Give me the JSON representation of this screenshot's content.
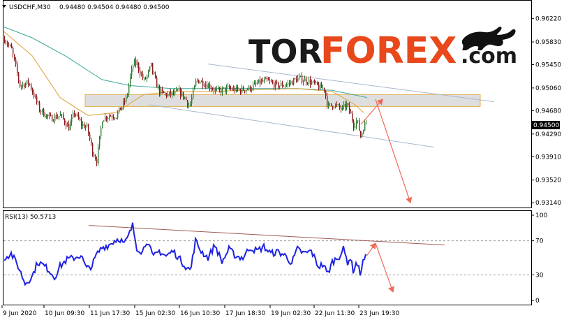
{
  "header": {
    "symbol": "USDCHF,M30",
    "ohlc": "0.94480 0.94504 0.94480 0.94500"
  },
  "logo": {
    "part1": "TOR",
    "part2": "FOREX",
    "part3": ".com"
  },
  "price_tag": "0.94500",
  "rsi_title": "RSI(13) 50.5713",
  "colors": {
    "bull_candle": "#2e7d32",
    "bear_candle": "#8b1a1a",
    "ma_fast": "#e0a030",
    "ma_slow": "#3aa89a",
    "channel": "#a8b8d0",
    "zone_fill": "#d8d8d8",
    "zone_border": "#e0b050",
    "arrow": "#ee6a5a",
    "rsi_line": "#1e22e0",
    "rsi_trend": "#a05a50",
    "logo_accent": "#e8481c"
  },
  "chart_data": [
    {
      "type": "candlestick",
      "title": "USDCHF,M30",
      "x_labels": [
        "9 Jun 2020",
        "10 Jun 09:30",
        "11 Jun 17:30",
        "15 Jun 02:30",
        "16 Jun 10:30",
        "17 Jun 18:30",
        "19 Jun 02:30",
        "22 Jun 11:30",
        "23 Jun 19:30"
      ],
      "y_ticks": [
        "0.96220",
        "0.95830",
        "0.95450",
        "0.95060",
        "0.94680",
        "0.94290",
        "0.93910",
        "0.93520",
        "0.93140"
      ],
      "ylim": [
        0.9306,
        0.9652
      ],
      "anchors": [
        [
          0,
          0.9588
        ],
        [
          10,
          0.957
        ],
        [
          22,
          0.951
        ],
        [
          35,
          0.9515
        ],
        [
          50,
          0.947
        ],
        [
          65,
          0.9455
        ],
        [
          80,
          0.946
        ],
        [
          92,
          0.944
        ],
        [
          100,
          0.9465
        ],
        [
          110,
          0.9445
        ],
        [
          118,
          0.944
        ],
        [
          126,
          0.94
        ],
        [
          132,
          0.9385
        ],
        [
          140,
          0.9455
        ],
        [
          150,
          0.946
        ],
        [
          160,
          0.946
        ],
        [
          168,
          0.9475
        ],
        [
          175,
          0.949
        ],
        [
          180,
          0.9525
        ],
        [
          185,
          0.9548
        ],
        [
          190,
          0.9545
        ],
        [
          195,
          0.953
        ],
        [
          200,
          0.9518
        ],
        [
          205,
          0.9528
        ],
        [
          210,
          0.9543
        ],
        [
          215,
          0.952
        ],
        [
          222,
          0.95
        ],
        [
          230,
          0.9495
        ],
        [
          240,
          0.9495
        ],
        [
          250,
          0.95
        ],
        [
          258,
          0.949
        ],
        [
          265,
          0.9475
        ],
        [
          275,
          0.952
        ],
        [
          290,
          0.9512
        ],
        [
          305,
          0.95
        ],
        [
          320,
          0.9505
        ],
        [
          335,
          0.9502
        ],
        [
          350,
          0.9505
        ],
        [
          365,
          0.9515
        ],
        [
          375,
          0.9518
        ],
        [
          390,
          0.951
        ],
        [
          405,
          0.9512
        ],
        [
          420,
          0.9522
        ],
        [
          435,
          0.9518
        ],
        [
          450,
          0.9508
        ],
        [
          458,
          0.9505
        ],
        [
          463,
          0.9475
        ],
        [
          473,
          0.9478
        ],
        [
          483,
          0.947
        ],
        [
          490,
          0.9478
        ],
        [
          495,
          0.9465
        ],
        [
          500,
          0.9445
        ],
        [
          505,
          0.9452
        ],
        [
          510,
          0.9425
        ],
        [
          514,
          0.944
        ],
        [
          518,
          0.945
        ]
      ],
      "ma_fast": [
        [
          0,
          0.96
        ],
        [
          40,
          0.956
        ],
        [
          80,
          0.949
        ],
        [
          120,
          0.946
        ],
        [
          160,
          0.9465
        ],
        [
          200,
          0.9495
        ],
        [
          240,
          0.95
        ],
        [
          300,
          0.95
        ],
        [
          360,
          0.9503
        ],
        [
          420,
          0.9505
        ],
        [
          470,
          0.95
        ],
        [
          500,
          0.948
        ],
        [
          515,
          0.9465
        ]
      ],
      "ma_slow": [
        [
          0,
          0.9608
        ],
        [
          40,
          0.959
        ],
        [
          90,
          0.9558
        ],
        [
          140,
          0.952
        ],
        [
          180,
          0.951
        ],
        [
          240,
          0.9505
        ],
        [
          300,
          0.9505
        ],
        [
          360,
          0.9505
        ],
        [
          420,
          0.9505
        ],
        [
          470,
          0.9502
        ],
        [
          520,
          0.949
        ]
      ],
      "channel_upper": [
        [
          292,
          0.9546
        ],
        [
          702,
          0.9483
        ]
      ],
      "channel_lower": [
        [
          207,
          0.9478
        ],
        [
          616,
          0.9407
        ]
      ],
      "zone": {
        "x0": 116,
        "x1": 682,
        "y_low": 0.9475,
        "y_high": 0.9495
      },
      "arrows": [
        {
          "from": [
            511,
            0.9445
          ],
          "to": [
            542,
            0.9487
          ]
        },
        {
          "from": [
            532,
            0.9487
          ],
          "to": [
            582,
            0.9314
          ]
        }
      ]
    },
    {
      "type": "line",
      "title": "RSI(13) 50.5713",
      "y_ticks": [
        "100",
        "70",
        "30",
        "0"
      ],
      "ylim": [
        0,
        100
      ],
      "levels": [
        30,
        70
      ],
      "anchors": [
        [
          0,
          50
        ],
        [
          10,
          55
        ],
        [
          20,
          40
        ],
        [
          30,
          20
        ],
        [
          40,
          28
        ],
        [
          48,
          45
        ],
        [
          55,
          42
        ],
        [
          65,
          35
        ],
        [
          72,
          27
        ],
        [
          80,
          40
        ],
        [
          90,
          48
        ],
        [
          100,
          50
        ],
        [
          110,
          53
        ],
        [
          118,
          37
        ],
        [
          126,
          41
        ],
        [
          132,
          53
        ],
        [
          140,
          62
        ],
        [
          150,
          65
        ],
        [
          158,
          70
        ],
        [
          165,
          73
        ],
        [
          172,
          66
        ],
        [
          178,
          75
        ],
        [
          184,
          88
        ],
        [
          190,
          62
        ],
        [
          198,
          57
        ],
        [
          205,
          72
        ],
        [
          213,
          50
        ],
        [
          222,
          58
        ],
        [
          232,
          52
        ],
        [
          242,
          58
        ],
        [
          252,
          48
        ],
        [
          260,
          40
        ],
        [
          267,
          35
        ],
        [
          274,
          70
        ],
        [
          282,
          58
        ],
        [
          292,
          50
        ],
        [
          302,
          65
        ],
        [
          312,
          45
        ],
        [
          322,
          60
        ],
        [
          332,
          52
        ],
        [
          342,
          50
        ],
        [
          352,
          62
        ],
        [
          362,
          58
        ],
        [
          372,
          63
        ],
        [
          382,
          55
        ],
        [
          392,
          57
        ],
        [
          402,
          53
        ],
        [
          412,
          44
        ],
        [
          420,
          60
        ],
        [
          430,
          55
        ],
        [
          440,
          58
        ],
        [
          450,
          40
        ],
        [
          458,
          42
        ],
        [
          463,
          30
        ],
        [
          470,
          45
        ],
        [
          480,
          52
        ],
        [
          486,
          60
        ],
        [
          492,
          45
        ],
        [
          496,
          50
        ],
        [
          500,
          35
        ],
        [
          505,
          45
        ],
        [
          510,
          32
        ],
        [
          515,
          48
        ],
        [
          518,
          50.57
        ]
      ],
      "trend": [
        [
          121,
          88
        ],
        [
          631,
          65
        ]
      ],
      "arrow": {
        "from": [
          519,
          52
        ],
        "to": [
          532,
          67
        ],
        "to2": [
          557,
          10
        ]
      }
    }
  ]
}
